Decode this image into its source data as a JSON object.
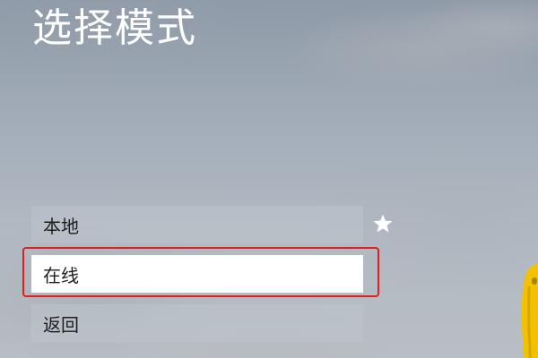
{
  "header": {
    "title": "选择模式"
  },
  "menu": {
    "items": [
      {
        "label": "本地",
        "selected": false,
        "favorite": true
      },
      {
        "label": "在线",
        "selected": true,
        "favorite": false
      },
      {
        "label": "返回",
        "selected": false,
        "favorite": false
      }
    ]
  },
  "icons": {
    "favorite": "star-icon"
  },
  "colors": {
    "title_text": "#ffffff",
    "selected_item_bg": "#ffffff",
    "item_bg": "#bec4cc",
    "selection_border": "#e02020",
    "character_yellow": "#f2c200"
  }
}
